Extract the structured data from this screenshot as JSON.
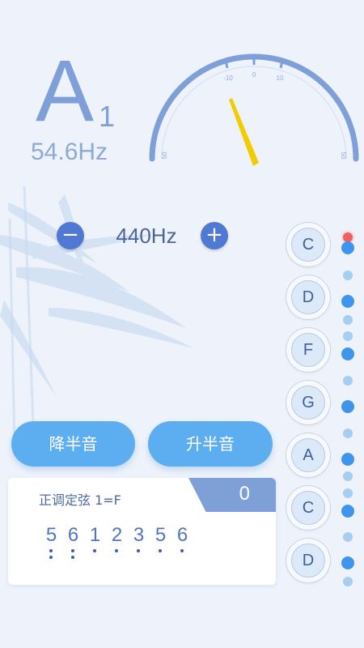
{
  "note": {
    "name": "A",
    "octave": "1",
    "frequency": "54.6Hz"
  },
  "gauge": {
    "ticks": [
      "-10",
      "0",
      "10"
    ],
    "left_label": "50",
    "right_label": "50",
    "needle_color": "#f1cd00",
    "arc_color": "#7f9fd8"
  },
  "reference": {
    "minus_label": "−",
    "value": "440Hz",
    "plus_label": "+"
  },
  "buttons": {
    "semitone_down": "降半音",
    "semitone_up": "升半音"
  },
  "card": {
    "title": "正调定弦 1=F",
    "value": "0",
    "notation": [
      {
        "digit": "5",
        "dots_below": 2
      },
      {
        "digit": "6",
        "dots_below": 2
      },
      {
        "digit": "1",
        "dots_below": 1
      },
      {
        "digit": "2",
        "dots_below": 1
      },
      {
        "digit": "3",
        "dots_below": 1
      },
      {
        "digit": "5",
        "dots_below": 1
      },
      {
        "digit": "6",
        "dots_below": 1
      }
    ]
  },
  "strings": [
    "C",
    "D",
    "F",
    "G",
    "A",
    "C",
    "D"
  ],
  "colors": {
    "accent": "#5caef0",
    "primary": "#4f79d2",
    "indicator": "#3f94ec",
    "alert": "#f06060"
  }
}
